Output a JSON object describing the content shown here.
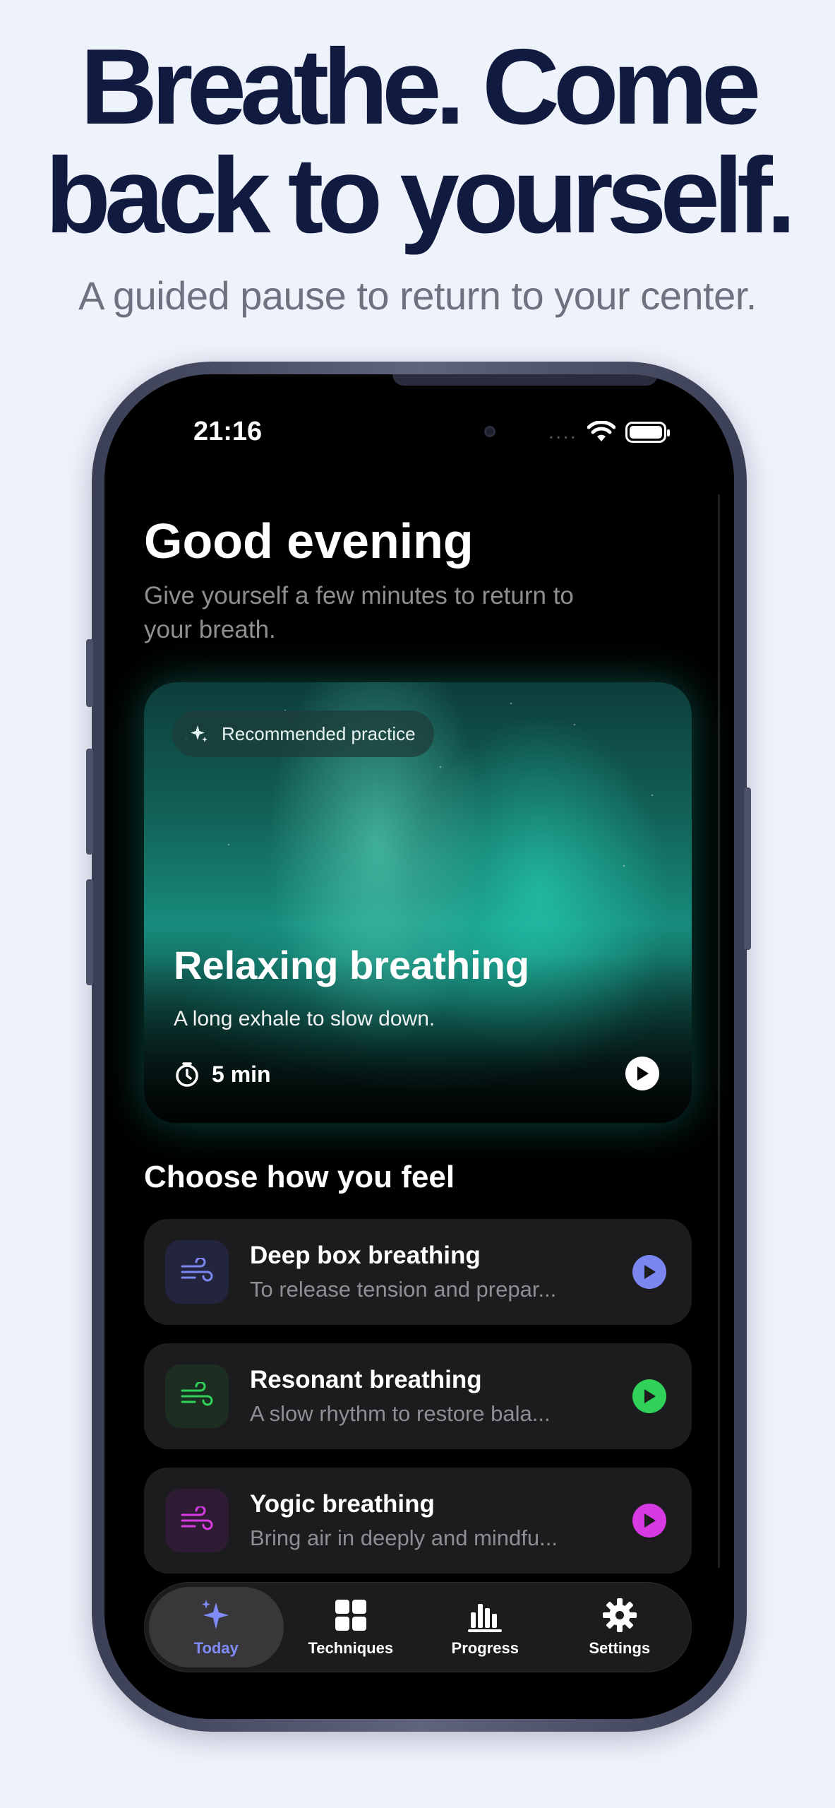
{
  "headline": {
    "line1": "Breathe. Come",
    "line2": "back to yourself."
  },
  "subhead": "A guided pause to return to your center.",
  "status_bar": {
    "time": "21:16",
    "dots": "....",
    "wifi_icon": "wifi-icon",
    "battery_icon": "battery-icon"
  },
  "home": {
    "greeting": "Good evening",
    "subtitle": "Give yourself a few minutes to return to your breath."
  },
  "featured": {
    "badge": "Recommended practice",
    "title": "Relaxing breathing",
    "description": "A long exhale to slow down.",
    "duration": "5 min",
    "accent": "#1fc9b0"
  },
  "section_title": "Choose how you feel",
  "practices": [
    {
      "title": "Deep box breathing",
      "subtitle": "To release tension and prepar...",
      "icon": "wind-icon",
      "color": "#7b86f0",
      "icon_bg": "#23253f"
    },
    {
      "title": "Resonant breathing",
      "subtitle": "A slow rhythm to restore bala...",
      "icon": "wind-icon",
      "color": "#30d158",
      "icon_bg": "#1c2e22"
    },
    {
      "title": "Yogic breathing",
      "subtitle": "Bring air in deeply and mindfu...",
      "icon": "wind-icon",
      "color": "#d63ae0",
      "icon_bg": "#2f1c34"
    }
  ],
  "tabs": [
    {
      "label": "Today",
      "icon": "sparkles-icon",
      "active": true
    },
    {
      "label": "Techniques",
      "icon": "grid-icon",
      "active": false
    },
    {
      "label": "Progress",
      "icon": "bar-chart-icon",
      "active": false
    },
    {
      "label": "Settings",
      "icon": "gear-icon",
      "active": false
    }
  ],
  "colors": {
    "page_bg": "#eef2fb",
    "headline": "#111a3f",
    "tab_active": "#7f8cf7"
  }
}
